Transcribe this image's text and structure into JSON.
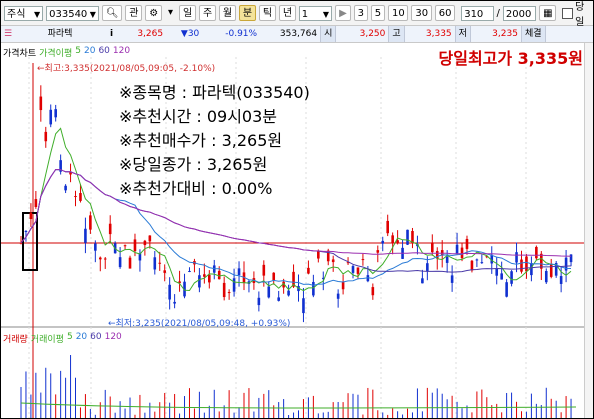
{
  "toolbar": {
    "market": "주식",
    "code": "033540",
    "tab_1": "관",
    "periods": [
      "일",
      "주",
      "월",
      "분",
      "틱",
      "년"
    ],
    "active_period_index": 3,
    "count_value": "1",
    "minute_options": [
      "3",
      "5",
      "10",
      "30",
      "60"
    ],
    "range_value": "310",
    "range_total": "2000",
    "checkbox_label": "당일"
  },
  "info": {
    "stock_name": "파라텍",
    "price": "3,265",
    "change": "▼30",
    "change_pct": "-0.91%",
    "volume": "353,764",
    "open_label": "시",
    "open": "3,250",
    "high_label": "고",
    "high": "3,335",
    "low_label": "저",
    "low": "3,235",
    "tail_label": "체결"
  },
  "legend": {
    "price_chart": "가격차트",
    "price_ma": "가격이평",
    "ma_periods": [
      "5",
      "20",
      "60",
      "120"
    ],
    "volume_chart": "거래량",
    "volume_ma": "거래이평"
  },
  "annotations": {
    "high_marker": "←최고:3,335(2021/08/05,09:05, -2.10%)",
    "low_marker": "←최저:3,235(2021/08/05,09:48, +0.93%)",
    "high_title": "당일최고가 3,335원"
  },
  "summary": {
    "line1": "※종목명 : 파라텍(033540)",
    "line2": "※추천시간 : 09시03분",
    "line3": "※추천매수가 : 3,265원",
    "line4": "※당일종가 : 3,265원",
    "line5": "※추천가대비 : 0.00%"
  },
  "colors": {
    "up": "#e00000",
    "down": "#1030d0",
    "ma5": "#3fae2a",
    "ma20": "#2a7bd6",
    "ma60": "#4a3aa8",
    "ma120": "#9b2fb0",
    "ref_line": "#d00000"
  }
}
